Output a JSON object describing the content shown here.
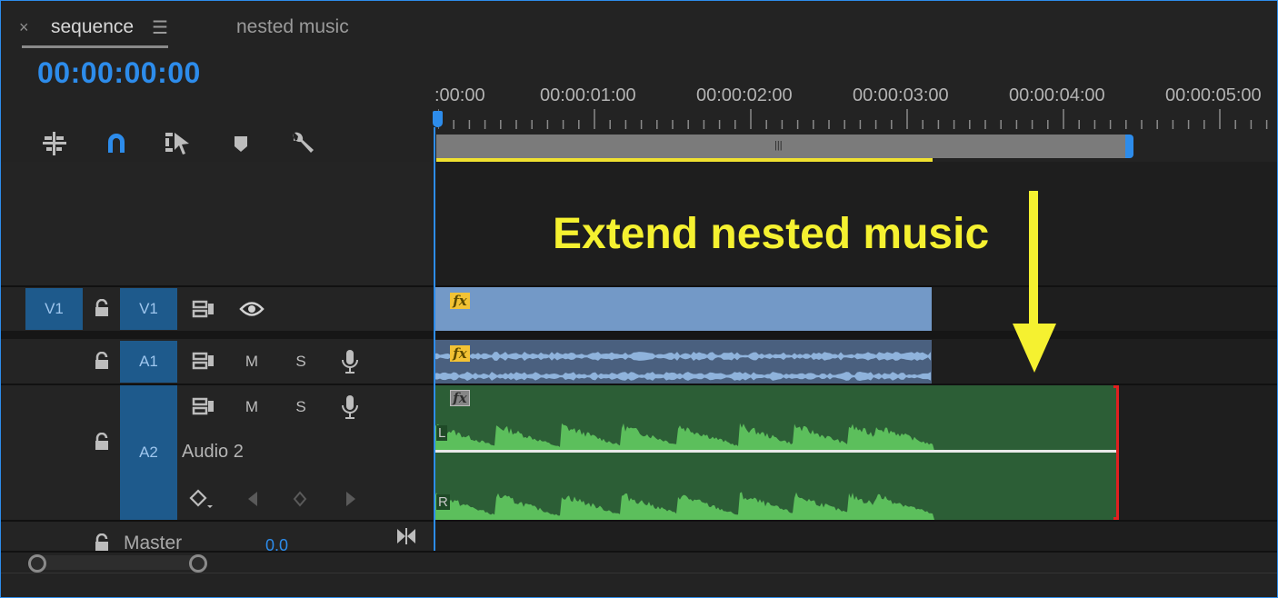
{
  "tabs": [
    {
      "close": "×",
      "label": "sequence",
      "menu": "☰"
    },
    {
      "label": "nested music"
    }
  ],
  "timecode": "00:00:00:00",
  "toolbar": {
    "icons": [
      "insert-sequence-as-nest-icon",
      "snap-magnet-icon",
      "linked-selection-icon",
      "add-marker-icon",
      "settings-wrench-icon"
    ]
  },
  "ruler": {
    "labels": [
      ":00:00",
      "00:00:01:00",
      "00:00:02:00",
      "00:00:03:00",
      "00:00:04:00",
      "00:00:05:00"
    ]
  },
  "tracks": {
    "v1": {
      "source": "V1",
      "target": "V1"
    },
    "a1": {
      "target": "A1",
      "mute": "M",
      "solo": "S"
    },
    "a2": {
      "target": "A2",
      "mute": "M",
      "solo": "S",
      "name": "Audio 2"
    },
    "master": {
      "label": "Master",
      "value": "0.0"
    }
  },
  "clips": {
    "fx_label": "fx",
    "channel_left": "L",
    "channel_right": "R"
  },
  "annotation": "Extend nested music",
  "colors": {
    "accent": "#2d8ceb",
    "annotation": "#f5f130",
    "video_clip": "#7399c7",
    "audio_clip_a1": "#4a607f",
    "audio_clip_a2": "#2c5e36",
    "waveform": "#5cbf5c",
    "trim_edge": "#e02020"
  }
}
